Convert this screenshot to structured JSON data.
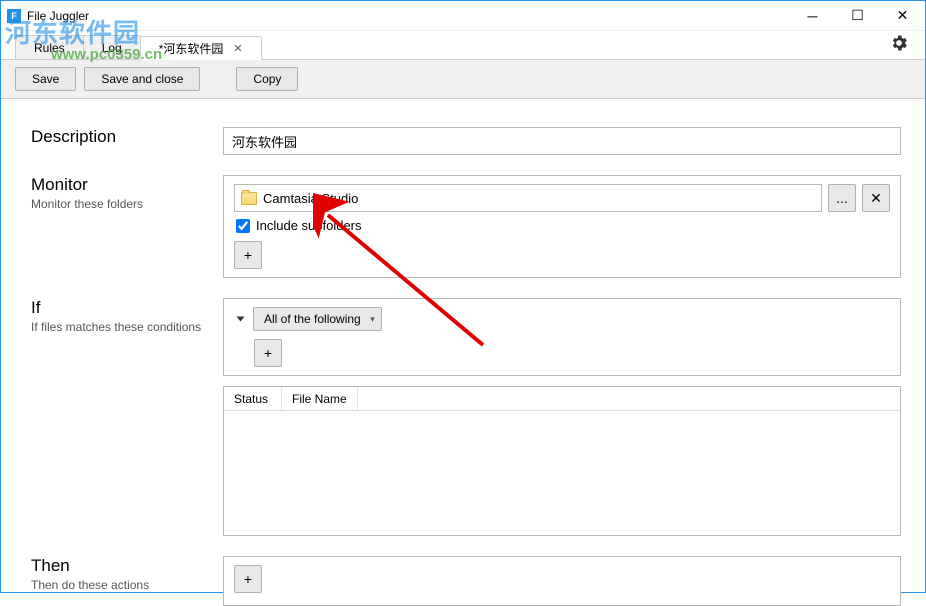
{
  "window": {
    "title": "File Juggler"
  },
  "watermark": {
    "text": "河东软件园",
    "url": "www.pc0359.cn"
  },
  "tabs": {
    "items": [
      {
        "label": "Rules"
      },
      {
        "label": "Log"
      },
      {
        "label": "*河东软件园"
      }
    ]
  },
  "toolbar": {
    "save": "Save",
    "save_close": "Save and close",
    "copy": "Copy"
  },
  "description": {
    "heading": "Description",
    "value": "河东软件园"
  },
  "monitor": {
    "heading": "Monitor",
    "sub": "Monitor these folders",
    "folder": "Camtasia Studio",
    "browse": "...",
    "remove": "✕",
    "include_label": "Include subfolders",
    "include_checked": true,
    "add": "+"
  },
  "if": {
    "heading": "If",
    "sub": "If files matches these conditions",
    "condition_select": "All of the following",
    "add": "+",
    "columns": {
      "status": "Status",
      "filename": "File Name"
    }
  },
  "then": {
    "heading": "Then",
    "sub": "Then do these actions",
    "add": "+"
  }
}
